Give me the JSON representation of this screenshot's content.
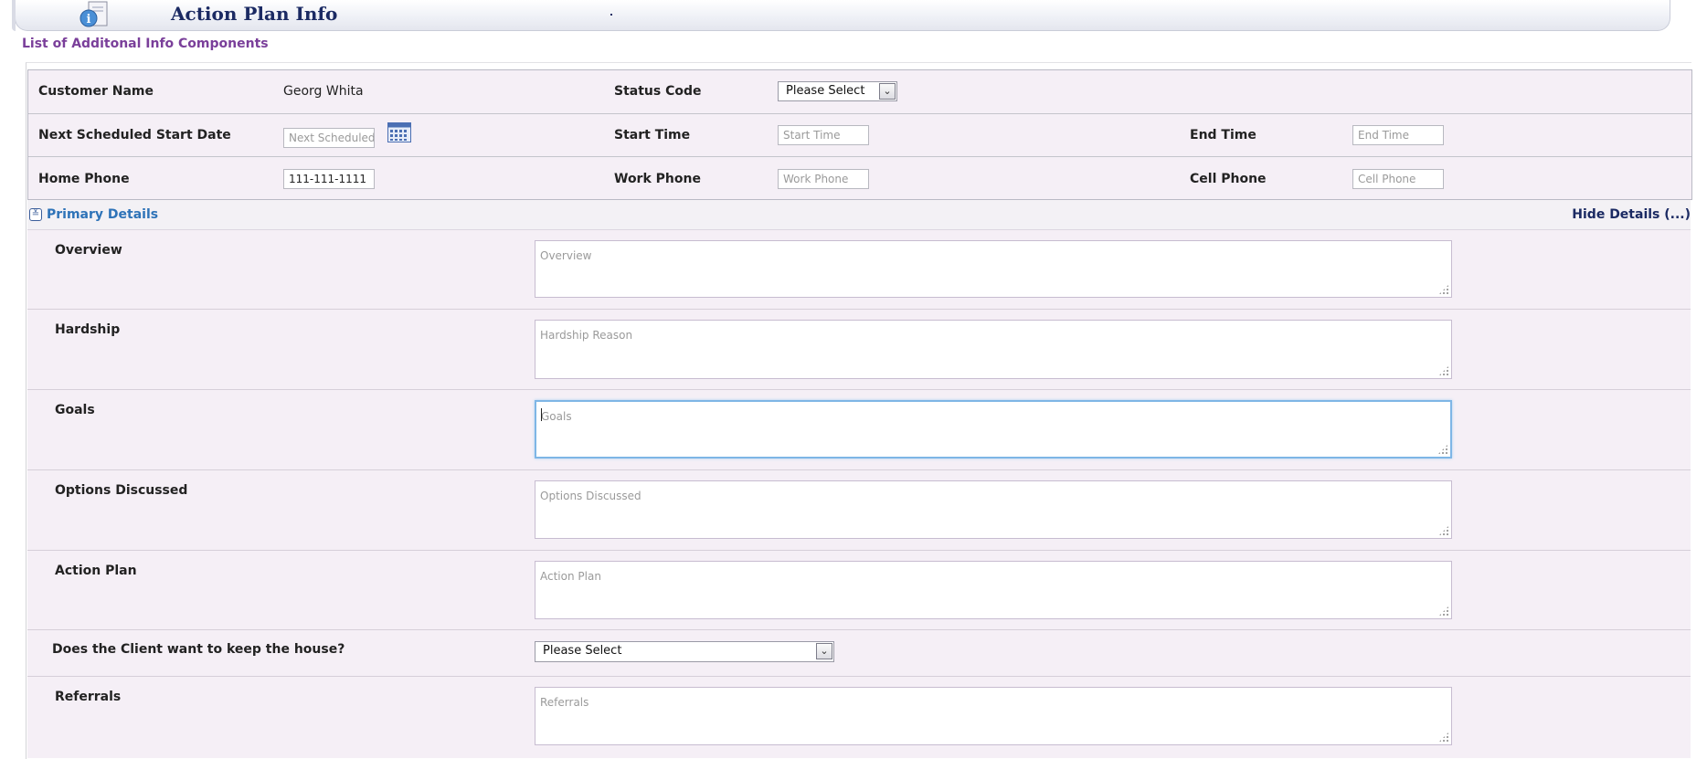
{
  "header": {
    "title": "Action Plan Info",
    "icon": "info-document-icon",
    "dot": "."
  },
  "section": {
    "heading": "List of Additonal Info Components"
  },
  "info": {
    "customer_name_label": "Customer Name",
    "customer_name_value": "Georg Whita",
    "status_code_label": "Status Code",
    "status_code_value": "Please Select",
    "next_start_label": "Next Scheduled Start Date",
    "next_start_placeholder": "Next Scheduled",
    "start_time_label": "Start Time",
    "start_time_placeholder": "Start Time",
    "end_time_label": "End Time",
    "end_time_placeholder": "End Time",
    "home_phone_label": "Home Phone",
    "home_phone_value": "111-111-1111",
    "work_phone_label": "Work Phone",
    "work_phone_placeholder": "Work Phone",
    "cell_phone_label": "Cell Phone",
    "cell_phone_placeholder": "Cell Phone"
  },
  "primary": {
    "title": "Primary Details",
    "hide_link": "Hide Details (...)",
    "toggle_glyph": "≚"
  },
  "details": {
    "overview": {
      "label": "Overview",
      "placeholder": "Overview"
    },
    "hardship": {
      "label": "Hardship",
      "placeholder": "Hardship Reason"
    },
    "goals": {
      "label": "Goals",
      "placeholder": "Goals"
    },
    "options": {
      "label": "Options Discussed",
      "placeholder": "Options Discussed"
    },
    "action_plan": {
      "label": "Action Plan",
      "placeholder": "Action Plan"
    },
    "keep_house": {
      "label": "Does the Client want to keep the house?",
      "value": "Please Select"
    },
    "referrals": {
      "label": "Referrals",
      "placeholder": "Referrals"
    }
  },
  "colors": {
    "title": "#1b2a63",
    "section_heading": "#7a3f9a",
    "link": "#2e73b8",
    "panel_bg": "#f5eff6",
    "focus_border": "#7eb6e6"
  }
}
